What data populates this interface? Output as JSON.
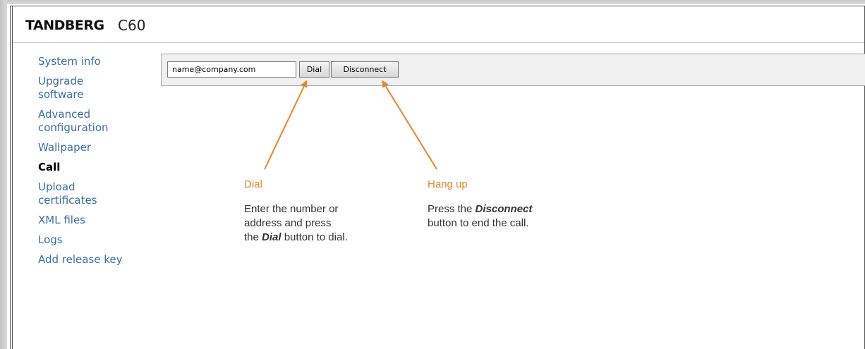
{
  "header": {
    "brand": "TANDBERG",
    "model": "C60"
  },
  "nav": {
    "items": [
      {
        "label": "System info",
        "active": false
      },
      {
        "label": "Upgrade\nsoftware",
        "active": false
      },
      {
        "label": "Advanced\nconfiguration",
        "active": false
      },
      {
        "label": "Wallpaper",
        "active": false
      },
      {
        "label": "Call",
        "active": true
      },
      {
        "label": "Upload\ncertificates",
        "active": false
      },
      {
        "label": "XML files",
        "active": false
      },
      {
        "label": "Logs",
        "active": false
      },
      {
        "label": "Add release key",
        "active": false
      }
    ]
  },
  "dial": {
    "address_value": "name@company.com",
    "dial_label": "Dial",
    "disconnect_label": "Disconnect"
  },
  "callouts": {
    "dial": {
      "title": "Dial",
      "line1": "Enter the number or",
      "line2": "address and press",
      "line3_pre": "the ",
      "line3_bold": "Dial",
      "line3_post": " button to dial."
    },
    "hangup": {
      "title": "Hang up",
      "line1_pre": "Press the ",
      "line1_bold": "Disconnect",
      "line2": "button to end the call."
    }
  },
  "colors": {
    "accent": "#e8852a",
    "link": "#3a6ea5"
  }
}
